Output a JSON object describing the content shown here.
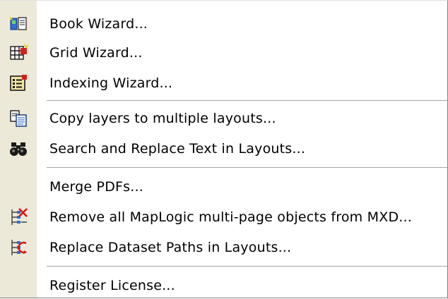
{
  "menu": {
    "items": [
      {
        "label": "Book Wizard...",
        "icon": "book-wizard-icon"
      },
      {
        "label": "Grid Wizard...",
        "icon": "grid-wizard-icon"
      },
      {
        "label": "Indexing Wizard...",
        "icon": "indexing-wizard-icon"
      },
      {
        "label": "Copy layers to multiple layouts...",
        "icon": "copy-layers-icon"
      },
      {
        "label": "Search and Replace Text in Layouts...",
        "icon": "binoculars-icon"
      },
      {
        "label": "Merge PDFs...",
        "icon": ""
      },
      {
        "label": "Remove all MapLogic multi-page objects from MXD...",
        "icon": "remove-objects-icon"
      },
      {
        "label": "Replace Dataset Paths in Layouts...",
        "icon": "replace-paths-icon"
      },
      {
        "label": "Register License...",
        "icon": ""
      }
    ]
  },
  "colors": {
    "gutter": "#ece9d8",
    "separator": "#a6a6a6"
  }
}
